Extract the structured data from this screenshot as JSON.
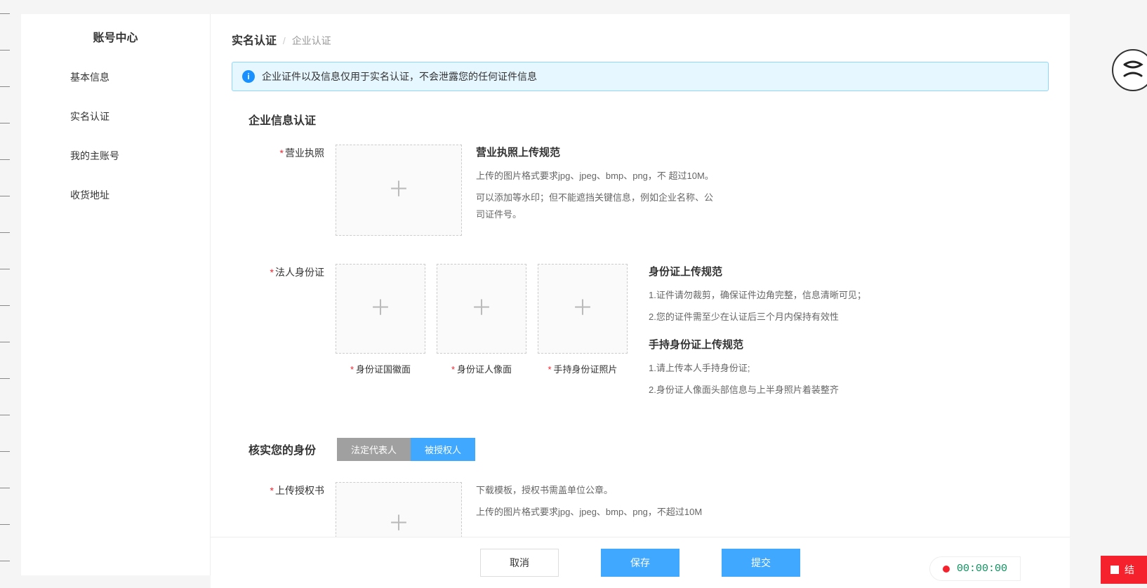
{
  "sidebar": {
    "title": "账号中心",
    "items": [
      "基本信息",
      "实名认证",
      "我的主账号",
      "收货地址"
    ]
  },
  "breadcrumb": {
    "main": "实名认证",
    "sep": "/",
    "sub": "企业认证"
  },
  "alert": {
    "text": "企业证件以及信息仅用于实名认证，不会泄露您的任何证件信息"
  },
  "section1": {
    "title": "企业信息认证",
    "row1": {
      "label": "营业执照",
      "hints_title": "营业执照上传规范",
      "hints1": "上传的图片格式要求jpg、jpeg、bmp、png，不 超过10M。",
      "hints2": "可以添加等水印；但不能遮挡关键信息，例如企业名称、公司证件号。"
    },
    "row2": {
      "label": "法人身份证",
      "captions": [
        "身份证国徽面",
        "身份证人像面",
        "手持身份证照片"
      ],
      "hints_title1": "身份证上传规范",
      "hints1": "1.证件请勿裁剪，确保证件边角完整，信息清晰可见；",
      "hints2": "2.您的证件需至少在认证后三个月内保持有效性",
      "hints_title2": "手持身份证上传规范",
      "hints3": "1.请上传本人手持身份证;",
      "hints4": "2.身份证人像面头部信息与上半身照片着装整齐"
    }
  },
  "section2": {
    "title": "核实您的身份",
    "tabs": [
      "法定代表人",
      "被授权人"
    ],
    "active_tab_index": 1,
    "row1": {
      "label": "上传授权书",
      "hints1": "下载模板，授权书需盖单位公章。",
      "hints2": "上传的图片格式要求jpg、jpeg、bmp、png，不超过10M"
    }
  },
  "footer": {
    "cancel": "取消",
    "save": "保存",
    "submit": "提交"
  },
  "timer": "00:00:00",
  "stop_label": "结"
}
